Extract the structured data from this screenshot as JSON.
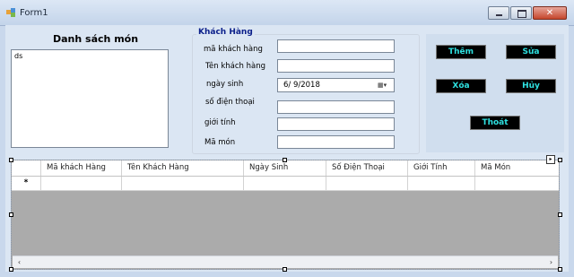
{
  "window": {
    "title": "Form1"
  },
  "menu_list": {
    "title": "Danh sách món",
    "items": [
      "ds"
    ]
  },
  "customer_group": {
    "legend": "Khách Hàng",
    "labels": {
      "id": "mã khách hàng",
      "name": "Tên khách hàng",
      "dob": "ngày sinh",
      "phone": "số điện thoại",
      "gender": "giới tính",
      "dish": "Mã món"
    },
    "dob_value": "6/  9/2018",
    "values": {
      "id": "",
      "name": "",
      "phone": "",
      "gender": "",
      "dish": ""
    }
  },
  "buttons": {
    "add": "Thêm",
    "edit": "Sửa",
    "delete": "Xóa",
    "cancel": "Hủy",
    "exit": "Thoát"
  },
  "grid": {
    "columns": [
      "Mã khách Hàng",
      "Tên Khách Hàng",
      "Ngày Sinh",
      "Số Điện Thoại",
      "Giới Tính",
      "Mã Món"
    ],
    "new_row_marker": "*"
  },
  "colors": {
    "button_bg": "#000000",
    "button_text": "#2ee0e0",
    "legend": "#0b1f8a"
  }
}
